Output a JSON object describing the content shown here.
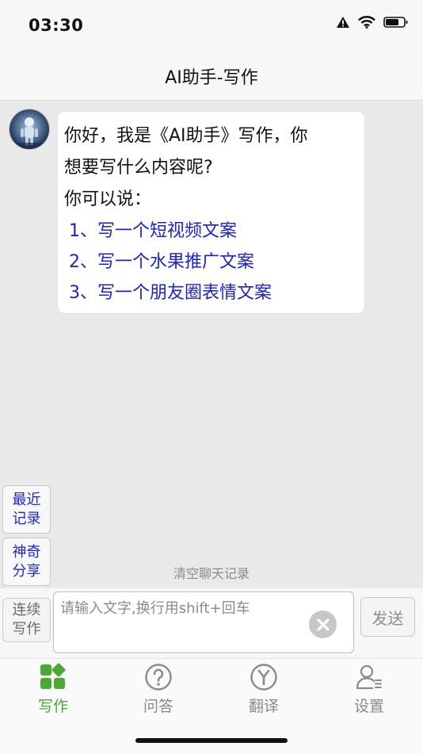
{
  "status_bar": {
    "time": "03:30"
  },
  "nav": {
    "title": "AI助手-写作"
  },
  "chat": {
    "message_lines": [
      "你好，我是《AI助手》写作，你",
      "想要写什么内容呢?",
      "你可以说："
    ],
    "suggestions": [
      "1、写一个短视频文案",
      "2、写一个水果推广文案",
      "3、写一个朋友圈表情文案"
    ]
  },
  "side_buttons": {
    "recent": [
      "最近",
      "记录"
    ],
    "share": [
      "神奇",
      "分享"
    ]
  },
  "clear_history_label": "清空聊天记录",
  "input": {
    "continue": [
      "连续",
      "写作"
    ],
    "placeholder": "请输入文字,换行用shift+回车",
    "value": "",
    "send_label": "发送"
  },
  "tabs": [
    {
      "label": "写作",
      "icon": "write-grid-icon",
      "active": true
    },
    {
      "label": "问答",
      "icon": "question-circle-icon",
      "active": false
    },
    {
      "label": "翻译",
      "icon": "translate-icon",
      "active": false
    },
    {
      "label": "设置",
      "icon": "user-settings-icon",
      "active": false
    }
  ],
  "colors": {
    "link_blue": "#1c23c9",
    "accent_green": "#4aa834",
    "muted_gray": "#8a8a8a"
  }
}
